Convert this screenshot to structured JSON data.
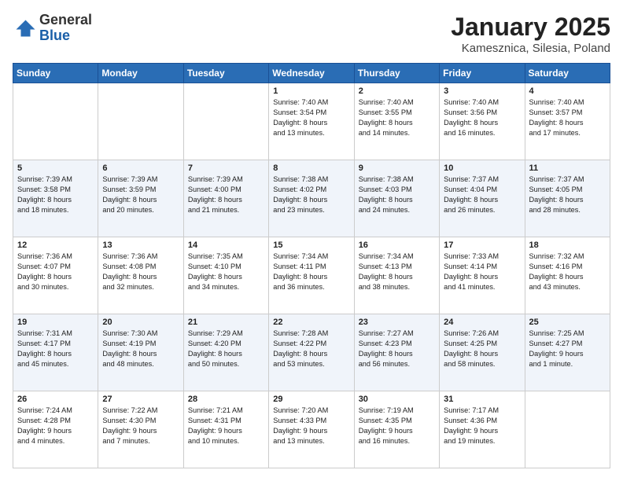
{
  "logo": {
    "general": "General",
    "blue": "Blue"
  },
  "title": "January 2025",
  "subtitle": "Kamesznica, Silesia, Poland",
  "headers": [
    "Sunday",
    "Monday",
    "Tuesday",
    "Wednesday",
    "Thursday",
    "Friday",
    "Saturday"
  ],
  "weeks": [
    [
      {
        "day": "",
        "info": ""
      },
      {
        "day": "",
        "info": ""
      },
      {
        "day": "",
        "info": ""
      },
      {
        "day": "1",
        "info": "Sunrise: 7:40 AM\nSunset: 3:54 PM\nDaylight: 8 hours\nand 13 minutes."
      },
      {
        "day": "2",
        "info": "Sunrise: 7:40 AM\nSunset: 3:55 PM\nDaylight: 8 hours\nand 14 minutes."
      },
      {
        "day": "3",
        "info": "Sunrise: 7:40 AM\nSunset: 3:56 PM\nDaylight: 8 hours\nand 16 minutes."
      },
      {
        "day": "4",
        "info": "Sunrise: 7:40 AM\nSunset: 3:57 PM\nDaylight: 8 hours\nand 17 minutes."
      }
    ],
    [
      {
        "day": "5",
        "info": "Sunrise: 7:39 AM\nSunset: 3:58 PM\nDaylight: 8 hours\nand 18 minutes."
      },
      {
        "day": "6",
        "info": "Sunrise: 7:39 AM\nSunset: 3:59 PM\nDaylight: 8 hours\nand 20 minutes."
      },
      {
        "day": "7",
        "info": "Sunrise: 7:39 AM\nSunset: 4:00 PM\nDaylight: 8 hours\nand 21 minutes."
      },
      {
        "day": "8",
        "info": "Sunrise: 7:38 AM\nSunset: 4:02 PM\nDaylight: 8 hours\nand 23 minutes."
      },
      {
        "day": "9",
        "info": "Sunrise: 7:38 AM\nSunset: 4:03 PM\nDaylight: 8 hours\nand 24 minutes."
      },
      {
        "day": "10",
        "info": "Sunrise: 7:37 AM\nSunset: 4:04 PM\nDaylight: 8 hours\nand 26 minutes."
      },
      {
        "day": "11",
        "info": "Sunrise: 7:37 AM\nSunset: 4:05 PM\nDaylight: 8 hours\nand 28 minutes."
      }
    ],
    [
      {
        "day": "12",
        "info": "Sunrise: 7:36 AM\nSunset: 4:07 PM\nDaylight: 8 hours\nand 30 minutes."
      },
      {
        "day": "13",
        "info": "Sunrise: 7:36 AM\nSunset: 4:08 PM\nDaylight: 8 hours\nand 32 minutes."
      },
      {
        "day": "14",
        "info": "Sunrise: 7:35 AM\nSunset: 4:10 PM\nDaylight: 8 hours\nand 34 minutes."
      },
      {
        "day": "15",
        "info": "Sunrise: 7:34 AM\nSunset: 4:11 PM\nDaylight: 8 hours\nand 36 minutes."
      },
      {
        "day": "16",
        "info": "Sunrise: 7:34 AM\nSunset: 4:13 PM\nDaylight: 8 hours\nand 38 minutes."
      },
      {
        "day": "17",
        "info": "Sunrise: 7:33 AM\nSunset: 4:14 PM\nDaylight: 8 hours\nand 41 minutes."
      },
      {
        "day": "18",
        "info": "Sunrise: 7:32 AM\nSunset: 4:16 PM\nDaylight: 8 hours\nand 43 minutes."
      }
    ],
    [
      {
        "day": "19",
        "info": "Sunrise: 7:31 AM\nSunset: 4:17 PM\nDaylight: 8 hours\nand 45 minutes."
      },
      {
        "day": "20",
        "info": "Sunrise: 7:30 AM\nSunset: 4:19 PM\nDaylight: 8 hours\nand 48 minutes."
      },
      {
        "day": "21",
        "info": "Sunrise: 7:29 AM\nSunset: 4:20 PM\nDaylight: 8 hours\nand 50 minutes."
      },
      {
        "day": "22",
        "info": "Sunrise: 7:28 AM\nSunset: 4:22 PM\nDaylight: 8 hours\nand 53 minutes."
      },
      {
        "day": "23",
        "info": "Sunrise: 7:27 AM\nSunset: 4:23 PM\nDaylight: 8 hours\nand 56 minutes."
      },
      {
        "day": "24",
        "info": "Sunrise: 7:26 AM\nSunset: 4:25 PM\nDaylight: 8 hours\nand 58 minutes."
      },
      {
        "day": "25",
        "info": "Sunrise: 7:25 AM\nSunset: 4:27 PM\nDaylight: 9 hours\nand 1 minute."
      }
    ],
    [
      {
        "day": "26",
        "info": "Sunrise: 7:24 AM\nSunset: 4:28 PM\nDaylight: 9 hours\nand 4 minutes."
      },
      {
        "day": "27",
        "info": "Sunrise: 7:22 AM\nSunset: 4:30 PM\nDaylight: 9 hours\nand 7 minutes."
      },
      {
        "day": "28",
        "info": "Sunrise: 7:21 AM\nSunset: 4:31 PM\nDaylight: 9 hours\nand 10 minutes."
      },
      {
        "day": "29",
        "info": "Sunrise: 7:20 AM\nSunset: 4:33 PM\nDaylight: 9 hours\nand 13 minutes."
      },
      {
        "day": "30",
        "info": "Sunrise: 7:19 AM\nSunset: 4:35 PM\nDaylight: 9 hours\nand 16 minutes."
      },
      {
        "day": "31",
        "info": "Sunrise: 7:17 AM\nSunset: 4:36 PM\nDaylight: 9 hours\nand 19 minutes."
      },
      {
        "day": "",
        "info": ""
      }
    ]
  ]
}
